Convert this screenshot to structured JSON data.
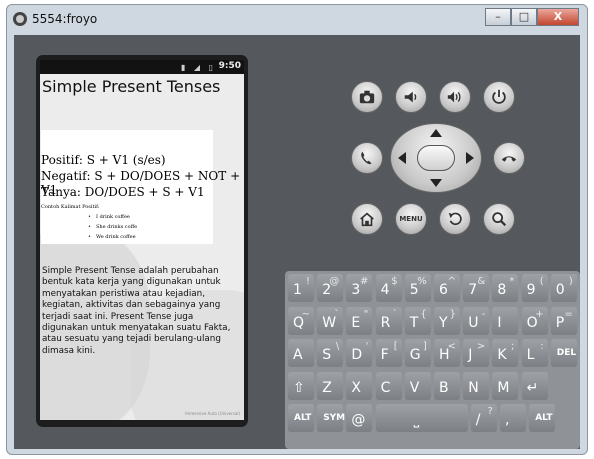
{
  "window": {
    "title": "5554:froyo",
    "minimize": "–",
    "maximize": "□",
    "close": "X"
  },
  "phone": {
    "status_time": "9:50",
    "app_title": "Simple Present Tenses",
    "formulas": [
      "Positif: S + V1 (s/es)",
      "Negatif: S + DO/DOES + NOT + V1",
      "Tanya: DO/DOES + S + V1"
    ],
    "examples_title": "Contoh Kalimat Positif:",
    "examples": [
      "I drink coffee",
      "She drinks coffe",
      "We drink coffee"
    ],
    "paragraph": "Simple Present Tense adalah perubahan bentuk kata kerja yang digunakan untuk menyatakan peristiwa atau kejadian, kegiatan, aktivitas dan sebagainya yang terjadi saat ini. Present Tense juga digunakan untuk menyatakan suatu Fakta, atau sesuatu yang tejadi berulang-ulang dimasa kini.",
    "footer": "Immersive Auto (Universal)"
  },
  "controls": {
    "buttons": [
      "camera-icon",
      "volume-down-icon",
      "volume-up-icon",
      "power-icon",
      "call-icon",
      "end-call-icon",
      "home-icon",
      "menu-icon",
      "back-icon",
      "search-icon"
    ],
    "menu_label": "MENU"
  },
  "keyboard": {
    "rows": [
      [
        [
          "1",
          "!"
        ],
        [
          "2",
          "@"
        ],
        [
          "3",
          "#"
        ],
        [
          "4",
          "$"
        ],
        [
          "5",
          "%"
        ],
        [
          "6",
          "^"
        ],
        [
          "7",
          "&"
        ],
        [
          "8",
          "*"
        ],
        [
          "9",
          "("
        ],
        [
          "0",
          ")"
        ]
      ],
      [
        [
          "Q",
          "~"
        ],
        [
          "W",
          "`"
        ],
        [
          "E",
          "\""
        ],
        [
          "R",
          "`"
        ],
        [
          "T",
          "{"
        ],
        [
          "Y",
          "}"
        ],
        [
          "U",
          "-"
        ],
        [
          "I",
          ""
        ],
        [
          "O",
          "+"
        ],
        [
          "P",
          "="
        ]
      ],
      [
        [
          "A",
          ""
        ],
        [
          "S",
          "\\"
        ],
        [
          "D",
          "'"
        ],
        [
          "F",
          "["
        ],
        [
          "G",
          "]"
        ],
        [
          "H",
          "<"
        ],
        [
          "J",
          ">"
        ],
        [
          "K",
          ";"
        ],
        [
          "L",
          ":"
        ],
        [
          "DEL",
          ""
        ]
      ],
      [
        [
          "⇧",
          ""
        ],
        [
          "Z",
          ""
        ],
        [
          "X",
          ""
        ],
        [
          "C",
          ""
        ],
        [
          "V",
          ""
        ],
        [
          "B",
          ""
        ],
        [
          "N",
          ""
        ],
        [
          "M",
          ""
        ],
        [
          "↵",
          ""
        ]
      ],
      [
        [
          "ALT",
          ""
        ],
        [
          "SYM",
          ""
        ],
        [
          "@",
          ""
        ],
        [
          "space",
          ""
        ],
        [
          "/",
          "?"
        ],
        [
          ",",
          ""
        ],
        [
          "ALT",
          ""
        ]
      ]
    ]
  }
}
